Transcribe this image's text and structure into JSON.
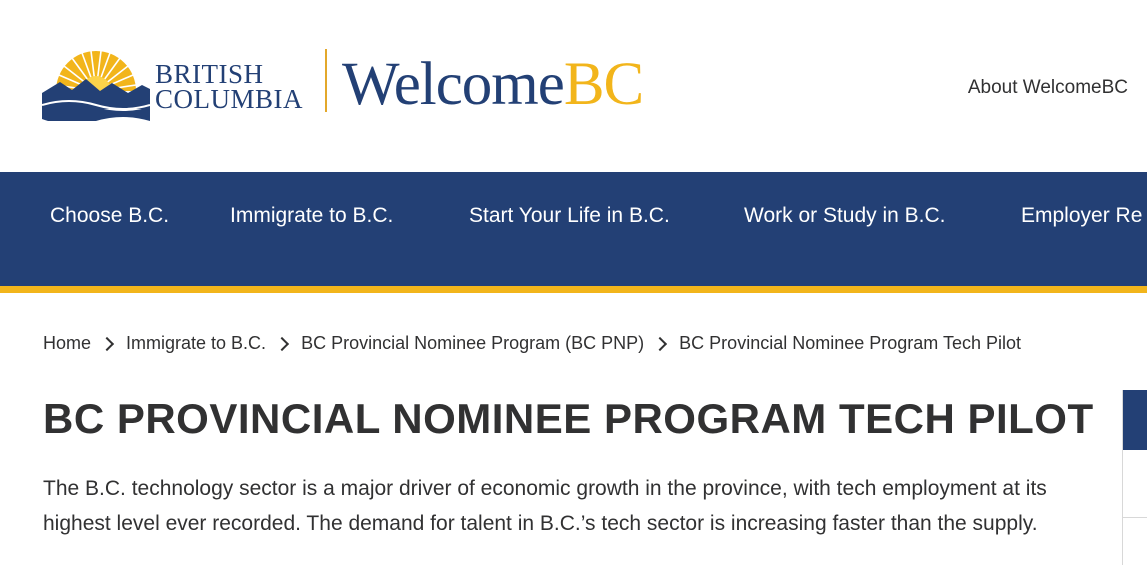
{
  "header": {
    "bc_logo_line1": "BRITISH",
    "bc_logo_line2": "COLUMBIA",
    "welcome_part1": "Welcome",
    "welcome_part2": "BC",
    "about_link": "About WelcomeBC"
  },
  "nav": {
    "items": [
      {
        "label": "Choose B.C."
      },
      {
        "label": "Immigrate to B.C."
      },
      {
        "label": "Start Your Life in B.C."
      },
      {
        "label": "Work or Study in B.C."
      },
      {
        "label": "Employer Re"
      }
    ]
  },
  "breadcrumb": [
    {
      "label": "Home"
    },
    {
      "label": "Immigrate to B.C."
    },
    {
      "label": "BC Provincial Nominee Program (BC PNP)"
    },
    {
      "label": "BC Provincial Nominee Program Tech Pilot"
    }
  ],
  "page": {
    "title": "BC PROVINCIAL NOMINEE PROGRAM TECH PILOT",
    "intro": "The B.C. technology sector is a major driver of economic growth in the province, with tech employment at its highest level ever recorded. The demand for talent in B.C.’s tech sector is increasing faster than the supply."
  },
  "colors": {
    "brand_blue": "#234075",
    "brand_gold": "#f2b51b",
    "text": "#313132"
  }
}
